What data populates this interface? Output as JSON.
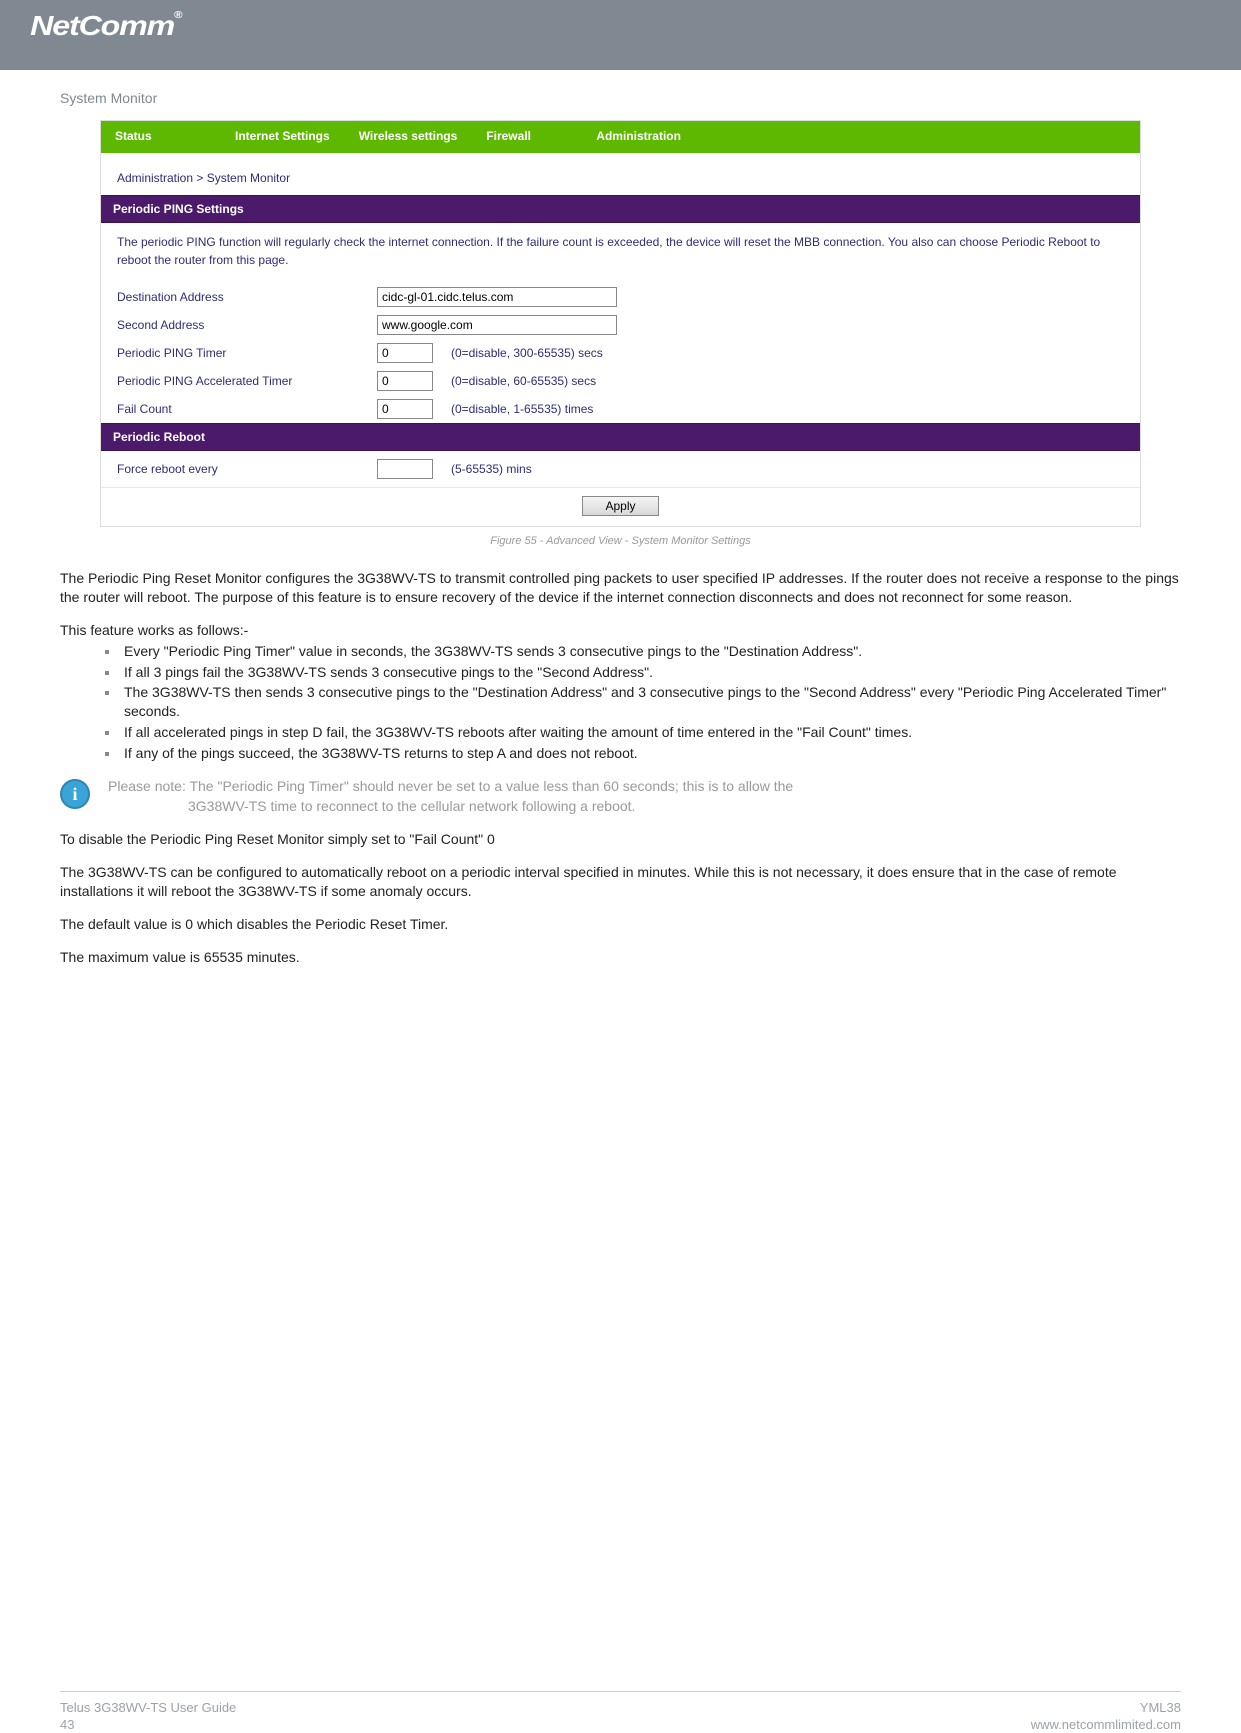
{
  "logo": "NetComm",
  "section_title": "System Monitor",
  "tabs": {
    "status": "Status",
    "internet": "Internet Settings",
    "wireless": "Wireless settings",
    "firewall": "Firewall",
    "admin": "Administration"
  },
  "breadcrumb": "Administration > System Monitor",
  "panel": {
    "ping_header": "Periodic PING Settings",
    "ping_desc": "The periodic PING function will regularly check the internet connection. If the failure count is exceeded, the device will reset the MBB connection. You also can choose Periodic Reboot to reboot the router from this page.",
    "rows": {
      "dest_label": "Destination Address",
      "dest_value": "cidc-gl-01.cidc.telus.com",
      "second_label": "Second Address",
      "second_value": "www.google.com",
      "timer_label": "Periodic PING Timer",
      "timer_value": "0",
      "timer_hint": "(0=disable, 300-65535) secs",
      "accel_label": "Periodic PING Accelerated Timer",
      "accel_value": "0",
      "accel_hint": "(0=disable, 60-65535) secs",
      "fail_label": "Fail Count",
      "fail_value": "0",
      "fail_hint": "(0=disable, 1-65535) times"
    },
    "reboot_header": "Periodic Reboot",
    "reboot_label": "Force reboot every",
    "reboot_value": "",
    "reboot_hint": "(5-65535) mins",
    "apply_label": "Apply"
  },
  "figure_caption": "Figure 55 - Advanced View - System Monitor Settings",
  "body": {
    "p1": "The Periodic Ping Reset Monitor configures the 3G38WV-TS to transmit controlled ping packets to user specified IP addresses. If the router does not receive a response to the pings the router will reboot. The purpose of this feature is to ensure recovery of the device if the internet connection disconnects and does not reconnect for some reason.",
    "p2": "This feature works as follows:-",
    "bullets": {
      "b1": "Every \"Periodic Ping Timer\" value in seconds, the 3G38WV-TS sends 3 consecutive pings to the \"Destination Address\".",
      "b2": "If all 3 pings fail the 3G38WV-TS sends 3 consecutive pings to the \"Second Address\".",
      "b3": "The 3G38WV-TS then sends 3 consecutive pings to the \"Destination Address\" and 3 consecutive pings to the \"Second Address\" every \"Periodic Ping Accelerated Timer\" seconds.",
      "b4": "If all accelerated pings in step D fail, the 3G38WV-TS reboots after waiting the amount of time entered in the \"Fail Count\" times.",
      "b5": "If any of the pings succeed, the 3G38WV-TS returns to step A and does not reboot."
    },
    "note_line1": "Please note: The \"Periodic Ping Timer\" should never be set to a value less than 60 seconds; this is to allow the",
    "note_line2": "3G38WV-TS time to reconnect to the cellular network following a reboot.",
    "p3": "To disable the Periodic Ping Reset Monitor simply set to \"Fail Count\" 0",
    "p4": "The 3G38WV-TS can be configured to automatically reboot on a periodic interval specified in minutes. While this is not necessary, it does ensure that in the case of remote installations it will reboot the 3G38WV-TS if some anomaly occurs.",
    "p5": "The default value is 0 which disables the Periodic Reset Timer.",
    "p6": "The maximum value is 65535 minutes."
  },
  "footer": {
    "left_line1": "Telus 3G38WV-TS User Guide",
    "left_line2": "43",
    "right_line1": "YML38",
    "right_line2": "www.netcommlimited.com"
  }
}
